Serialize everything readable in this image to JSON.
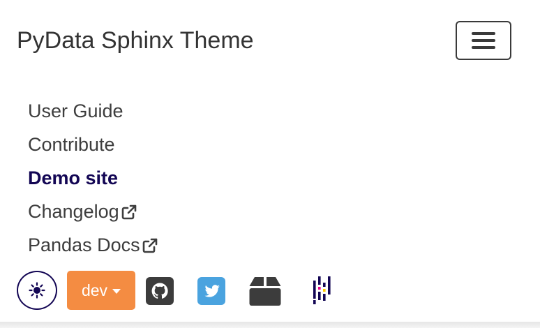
{
  "header": {
    "brand_title": "PyData Sphinx Theme",
    "menu_toggle_icon": "hamburger-menu-icon"
  },
  "nav": {
    "items": [
      {
        "label": "User Guide",
        "active": false,
        "external": false
      },
      {
        "label": "Contribute",
        "active": false,
        "external": false
      },
      {
        "label": "Demo site",
        "active": true,
        "external": false
      },
      {
        "label": "Changelog",
        "active": false,
        "external": true
      },
      {
        "label": "Pandas Docs",
        "active": false,
        "external": true
      }
    ]
  },
  "toolbar": {
    "theme_switch_icon": "sun-icon",
    "version_label": "dev",
    "links": [
      {
        "icon": "github-icon"
      },
      {
        "icon": "twitter-icon"
      },
      {
        "icon": "package-box-icon"
      },
      {
        "icon": "pandas-logo-icon"
      }
    ]
  },
  "colors": {
    "active_link": "#130654",
    "text": "#3d3d3d",
    "version_button": "#f48c42",
    "twitter": "#4aa3df",
    "icon_dark": "#3c3c3c"
  }
}
